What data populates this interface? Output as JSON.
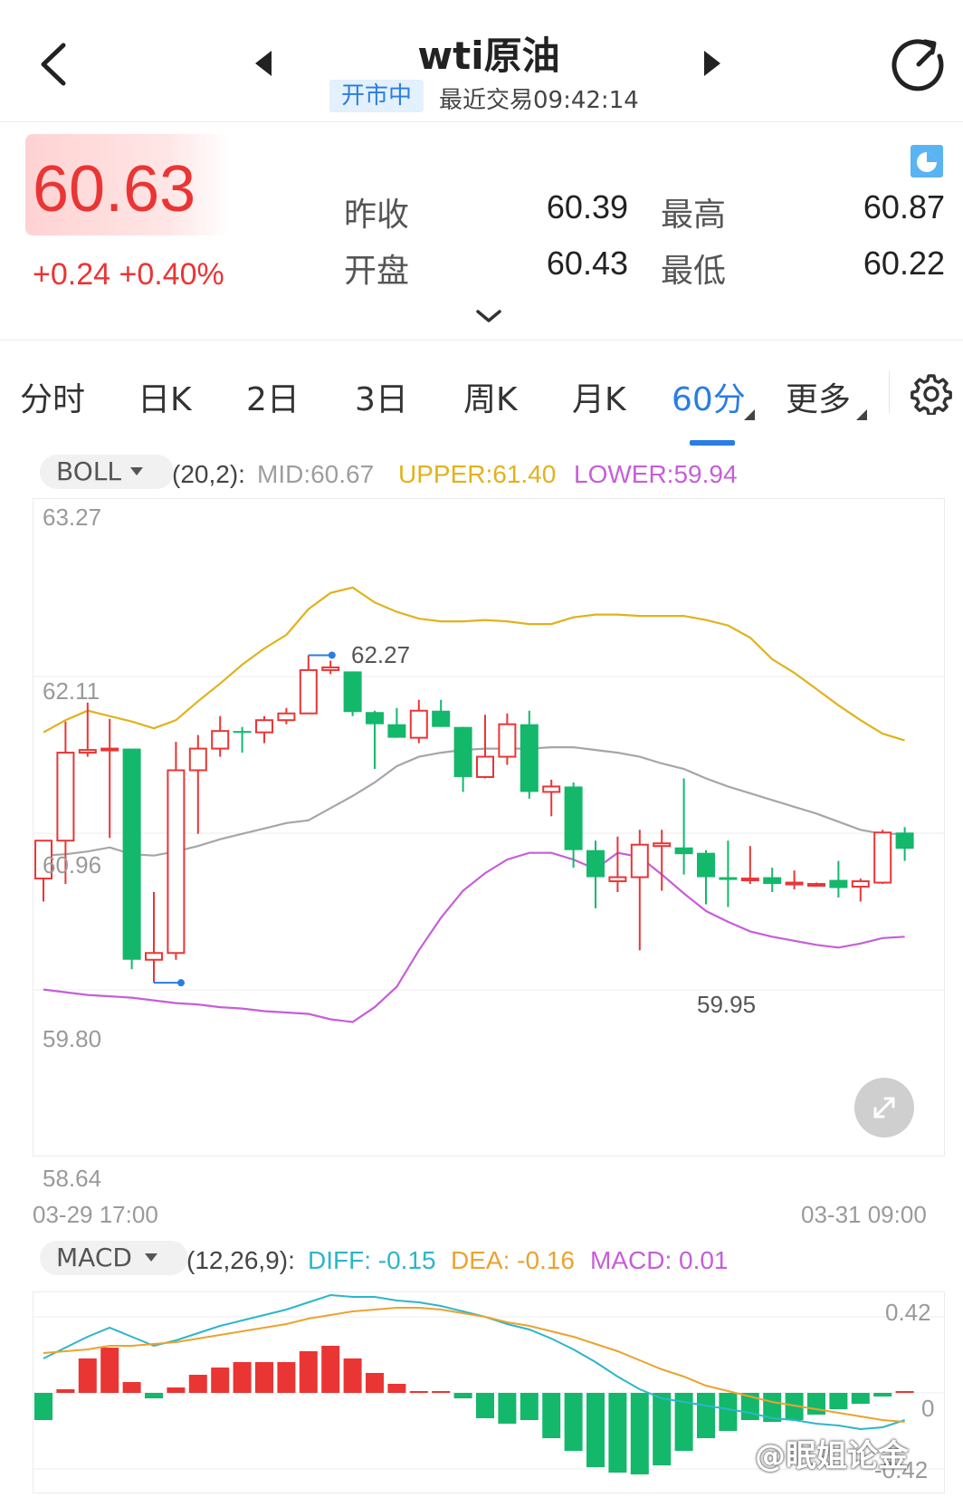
{
  "header": {
    "title": "wti原油",
    "status_badge": "开市中",
    "last_trade": "最近交易09:42:14"
  },
  "quote": {
    "price": "60.63",
    "change": "+0.24 +0.40%",
    "prev_close_label": "昨收",
    "prev_close": "60.39",
    "high_label": "最高",
    "high": "60.87",
    "open_label": "开盘",
    "open": "60.43",
    "low_label": "最低",
    "low": "60.22"
  },
  "tabs": [
    {
      "label": "分时"
    },
    {
      "label": "日K"
    },
    {
      "label": "2日"
    },
    {
      "label": "3日"
    },
    {
      "label": "周K"
    },
    {
      "label": "月K"
    },
    {
      "label": "60分",
      "active": true
    },
    {
      "label": "更多"
    }
  ],
  "icons": {
    "back": "chevron-left-icon",
    "prev": "triangle-left-icon",
    "next": "triangle-right-icon",
    "refresh": "refresh-icon",
    "chart_type": "pie-chart-icon",
    "settings": "gear-icon",
    "fullscreen": "expand-arrows-icon"
  },
  "colors": {
    "up": "#ea3535",
    "down": "#13b86b",
    "accent": "#2a7de1",
    "mid": "#a6a6a6",
    "upper": "#e1b21d",
    "lower": "#c65ed8",
    "diff": "#2cb6c8",
    "dea": "#eaa330",
    "macd": "#c65ed8"
  },
  "boll": {
    "indicator": "BOLL",
    "params": "(20,2):",
    "mid_label": "MID:60.67",
    "upper_label": "UPPER:61.40",
    "lower_label": "LOWER:59.94"
  },
  "macd": {
    "indicator": "MACD",
    "params": "(12,26,9):",
    "diff_label": "DIFF: -0.15",
    "dea_label": "DEA: -0.16",
    "macd_label": "MACD: 0.01"
  },
  "watermark": "@眠姐论金",
  "chart_data": [
    {
      "type": "candlestick",
      "indicator": "BOLL",
      "y_ticks": [
        "63.27",
        "62.11",
        "60.96",
        "59.80",
        "58.64"
      ],
      "ylim": [
        58.64,
        63.27
      ],
      "x_range": [
        "03-29 17:00",
        "03-31 09:00"
      ],
      "max_annotation": "62.27",
      "min_annotation": "59.95",
      "candles": [
        {
          "o": 60.62,
          "h": 60.75,
          "l": 60.45,
          "c": 60.9
        },
        {
          "o": 60.9,
          "h": 61.78,
          "l": 60.58,
          "c": 61.55
        },
        {
          "o": 61.55,
          "h": 61.92,
          "l": 61.52,
          "c": 61.57
        },
        {
          "o": 61.58,
          "h": 61.8,
          "l": 60.92,
          "c": 61.58
        },
        {
          "o": 61.58,
          "h": 61.58,
          "l": 59.95,
          "c": 60.02
        },
        {
          "o": 60.02,
          "h": 60.52,
          "l": 59.85,
          "c": 60.07
        },
        {
          "o": 60.07,
          "h": 61.63,
          "l": 60.02,
          "c": 61.42
        },
        {
          "o": 61.42,
          "h": 61.68,
          "l": 60.95,
          "c": 61.58
        },
        {
          "o": 61.58,
          "h": 61.82,
          "l": 61.52,
          "c": 61.71
        },
        {
          "o": 61.71,
          "h": 61.74,
          "l": 61.55,
          "c": 61.7
        },
        {
          "o": 61.7,
          "h": 61.82,
          "l": 61.62,
          "c": 61.79
        },
        {
          "o": 61.79,
          "h": 61.88,
          "l": 61.76,
          "c": 61.84
        },
        {
          "o": 61.84,
          "h": 62.27,
          "l": 61.92,
          "c": 62.16
        },
        {
          "o": 62.16,
          "h": 62.23,
          "l": 62.13,
          "c": 62.18
        },
        {
          "o": 62.15,
          "h": 62.15,
          "l": 61.82,
          "c": 61.85
        },
        {
          "o": 61.85,
          "h": 61.86,
          "l": 61.43,
          "c": 61.76
        },
        {
          "o": 61.76,
          "h": 61.88,
          "l": 61.66,
          "c": 61.66
        },
        {
          "o": 61.66,
          "h": 61.94,
          "l": 61.62,
          "c": 61.86
        },
        {
          "o": 61.86,
          "h": 61.94,
          "l": 61.78,
          "c": 61.74
        },
        {
          "o": 61.74,
          "h": 61.7,
          "l": 61.26,
          "c": 61.37
        },
        {
          "o": 61.37,
          "h": 61.83,
          "l": 61.36,
          "c": 61.52
        },
        {
          "o": 61.52,
          "h": 61.84,
          "l": 61.46,
          "c": 61.76
        },
        {
          "o": 61.76,
          "h": 61.86,
          "l": 61.21,
          "c": 61.26
        },
        {
          "o": 61.26,
          "h": 61.35,
          "l": 61.08,
          "c": 61.3
        },
        {
          "o": 61.3,
          "h": 61.33,
          "l": 60.7,
          "c": 60.83
        },
        {
          "o": 60.83,
          "h": 60.9,
          "l": 60.4,
          "c": 60.63
        },
        {
          "o": 60.6,
          "h": 60.93,
          "l": 60.52,
          "c": 60.63
        },
        {
          "o": 60.63,
          "h": 60.98,
          "l": 60.09,
          "c": 60.87
        },
        {
          "o": 60.86,
          "h": 60.98,
          "l": 60.53,
          "c": 60.88
        },
        {
          "o": 60.85,
          "h": 61.36,
          "l": 60.65,
          "c": 60.8
        },
        {
          "o": 60.81,
          "h": 60.83,
          "l": 60.43,
          "c": 60.63
        },
        {
          "o": 60.63,
          "h": 60.9,
          "l": 60.41,
          "c": 60.61
        },
        {
          "o": 60.62,
          "h": 60.86,
          "l": 60.58,
          "c": 60.62
        },
        {
          "o": 60.63,
          "h": 60.7,
          "l": 60.52,
          "c": 60.58
        },
        {
          "o": 60.59,
          "h": 60.68,
          "l": 60.54,
          "c": 60.59
        },
        {
          "o": 60.58,
          "h": 60.59,
          "l": 60.57,
          "c": 60.58
        },
        {
          "o": 60.61,
          "h": 60.75,
          "l": 60.48,
          "c": 60.55
        },
        {
          "o": 60.56,
          "h": 60.62,
          "l": 60.45,
          "c": 60.6
        },
        {
          "o": 60.59,
          "h": 60.98,
          "l": 60.58,
          "c": 60.96
        },
        {
          "o": 60.96,
          "h": 61.0,
          "l": 60.75,
          "c": 60.84
        }
      ],
      "series": [
        {
          "name": "MID",
          "values": [
            60.79,
            60.8,
            60.82,
            60.85,
            60.8,
            60.79,
            60.82,
            60.86,
            60.91,
            60.95,
            60.99,
            61.03,
            61.05,
            61.14,
            61.23,
            61.33,
            61.45,
            61.52,
            61.55,
            61.57,
            61.58,
            61.58,
            61.58,
            61.59,
            61.59,
            61.57,
            61.55,
            61.52,
            61.47,
            61.43,
            61.36,
            61.3,
            61.25,
            61.2,
            61.15,
            61.1,
            61.04,
            60.98,
            60.95,
            60.95
          ]
        },
        {
          "name": "UPPER",
          "values": [
            61.7,
            61.79,
            61.86,
            61.82,
            61.78,
            61.73,
            61.79,
            61.93,
            62.06,
            62.2,
            62.32,
            62.42,
            62.61,
            62.73,
            62.77,
            62.66,
            62.59,
            62.54,
            62.52,
            62.52,
            62.53,
            62.52,
            62.5,
            62.5,
            62.55,
            62.57,
            62.57,
            62.56,
            62.56,
            62.56,
            62.53,
            62.49,
            62.4,
            62.24,
            62.14,
            62.02,
            61.9,
            61.79,
            61.69,
            61.64
          ]
        },
        {
          "name": "LOWER",
          "values": [
            59.8,
            59.78,
            59.76,
            59.75,
            59.74,
            59.72,
            59.7,
            59.69,
            59.67,
            59.66,
            59.64,
            59.63,
            59.62,
            59.58,
            59.56,
            59.67,
            59.82,
            60.09,
            60.33,
            60.53,
            60.66,
            60.76,
            60.81,
            60.81,
            60.76,
            60.69,
            60.81,
            60.78,
            60.65,
            60.51,
            60.38,
            60.3,
            60.23,
            60.19,
            60.16,
            60.13,
            60.11,
            60.14,
            60.18,
            60.19
          ]
        }
      ]
    },
    {
      "type": "bar",
      "indicator": "MACD",
      "y_ticks": [
        "0.42",
        "0",
        "-0.42"
      ],
      "ylim": [
        -0.52,
        0.52
      ],
      "series": [
        {
          "name": "MACD",
          "values": [
            -0.15,
            0.02,
            0.19,
            0.25,
            0.06,
            -0.03,
            0.03,
            0.1,
            0.14,
            0.17,
            0.17,
            0.17,
            0.23,
            0.26,
            0.19,
            0.11,
            0.05,
            0.01,
            0.01,
            -0.03,
            -0.14,
            -0.17,
            -0.15,
            -0.25,
            -0.32,
            -0.41,
            -0.44,
            -0.45,
            -0.4,
            -0.32,
            -0.25,
            -0.21,
            -0.15,
            -0.16,
            -0.15,
            -0.12,
            -0.09,
            -0.06,
            -0.02,
            0.01
          ]
        },
        {
          "name": "DIFF",
          "values": [
            0.19,
            0.25,
            0.31,
            0.36,
            0.31,
            0.26,
            0.29,
            0.33,
            0.37,
            0.4,
            0.43,
            0.46,
            0.5,
            0.54,
            0.53,
            0.53,
            0.51,
            0.5,
            0.48,
            0.45,
            0.42,
            0.38,
            0.35,
            0.3,
            0.24,
            0.17,
            0.09,
            0.02,
            -0.03,
            -0.05,
            -0.07,
            -0.09,
            -0.11,
            -0.14,
            -0.15,
            -0.17,
            -0.18,
            -0.2,
            -0.19,
            -0.15
          ]
        },
        {
          "name": "DEA",
          "values": [
            0.22,
            0.23,
            0.24,
            0.26,
            0.26,
            0.27,
            0.28,
            0.3,
            0.32,
            0.34,
            0.36,
            0.38,
            0.41,
            0.43,
            0.45,
            0.46,
            0.47,
            0.47,
            0.46,
            0.44,
            0.42,
            0.39,
            0.37,
            0.34,
            0.31,
            0.27,
            0.23,
            0.18,
            0.13,
            0.09,
            0.04,
            0.01,
            -0.02,
            -0.05,
            -0.07,
            -0.09,
            -0.11,
            -0.13,
            -0.15,
            -0.16
          ]
        }
      ]
    }
  ]
}
